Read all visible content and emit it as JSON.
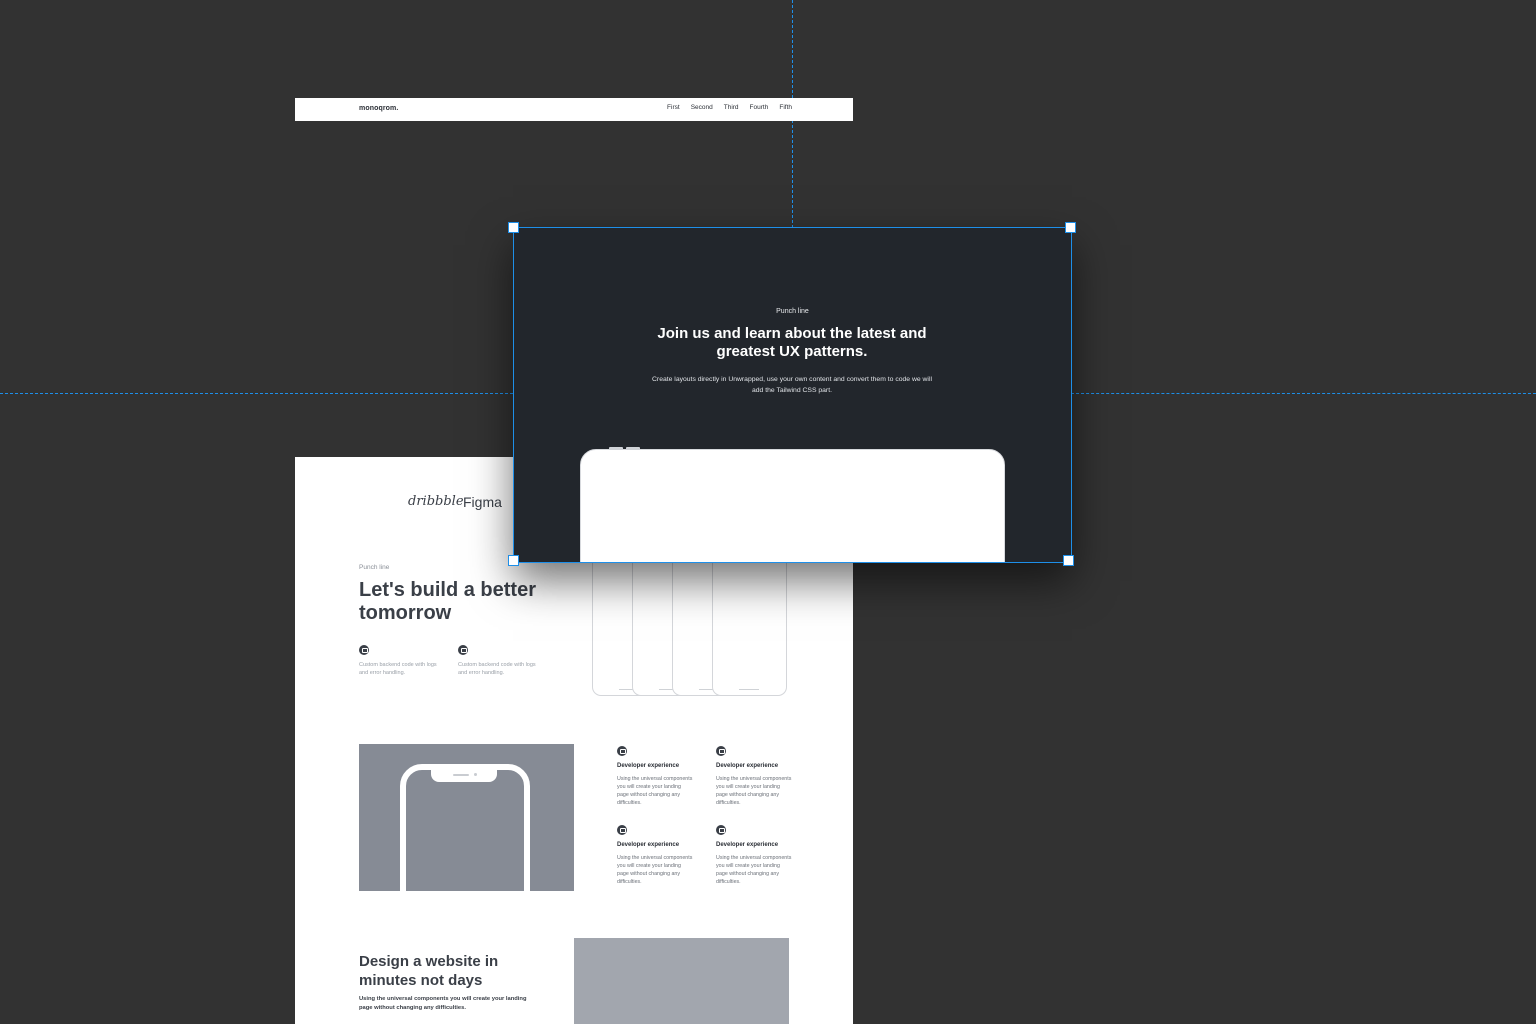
{
  "navbar": {
    "logo": "monoqrom.",
    "links": [
      "First",
      "Second",
      "Third",
      "Fourth",
      "Fifth"
    ]
  },
  "selected_section": {
    "kicker": "Punch line",
    "title": "Join us and learn about the latest and greatest UX patterns.",
    "text": "Create layouts directly in Unwrapped, use your own content and convert them to code we will add the Tailwind CSS part."
  },
  "brands": [
    "dribbble",
    "Figma"
  ],
  "hero": {
    "kicker": "Punch line",
    "title": "Let's build a better tomorrow",
    "features": [
      "Custom backend code with logs and error handling.",
      "Custom backend code with logs and error handling."
    ]
  },
  "dev_features": [
    {
      "title": "Developer experience",
      "text": "Using the universal components you will create your landing page without changing any difficulties."
    },
    {
      "title": "Developer experience",
      "text": "Using the universal components you will create your landing page without changing any difficulties."
    },
    {
      "title": "Developer experience",
      "text": "Using the universal components you will create your landing page without changing any difficulties."
    },
    {
      "title": "Developer experience",
      "text": "Using the universal components you will create your landing page without changing any difficulties."
    }
  ],
  "design": {
    "title": "Design a website in minutes not days",
    "text": "Using the universal components you will create your landing page without changing any difficulties."
  },
  "colors": {
    "canvas": "#323232",
    "selection": "#1e8fe8",
    "dark_section": "#22262c",
    "text_dark": "#3a3f47"
  },
  "icons": [
    "mail-icon"
  ]
}
